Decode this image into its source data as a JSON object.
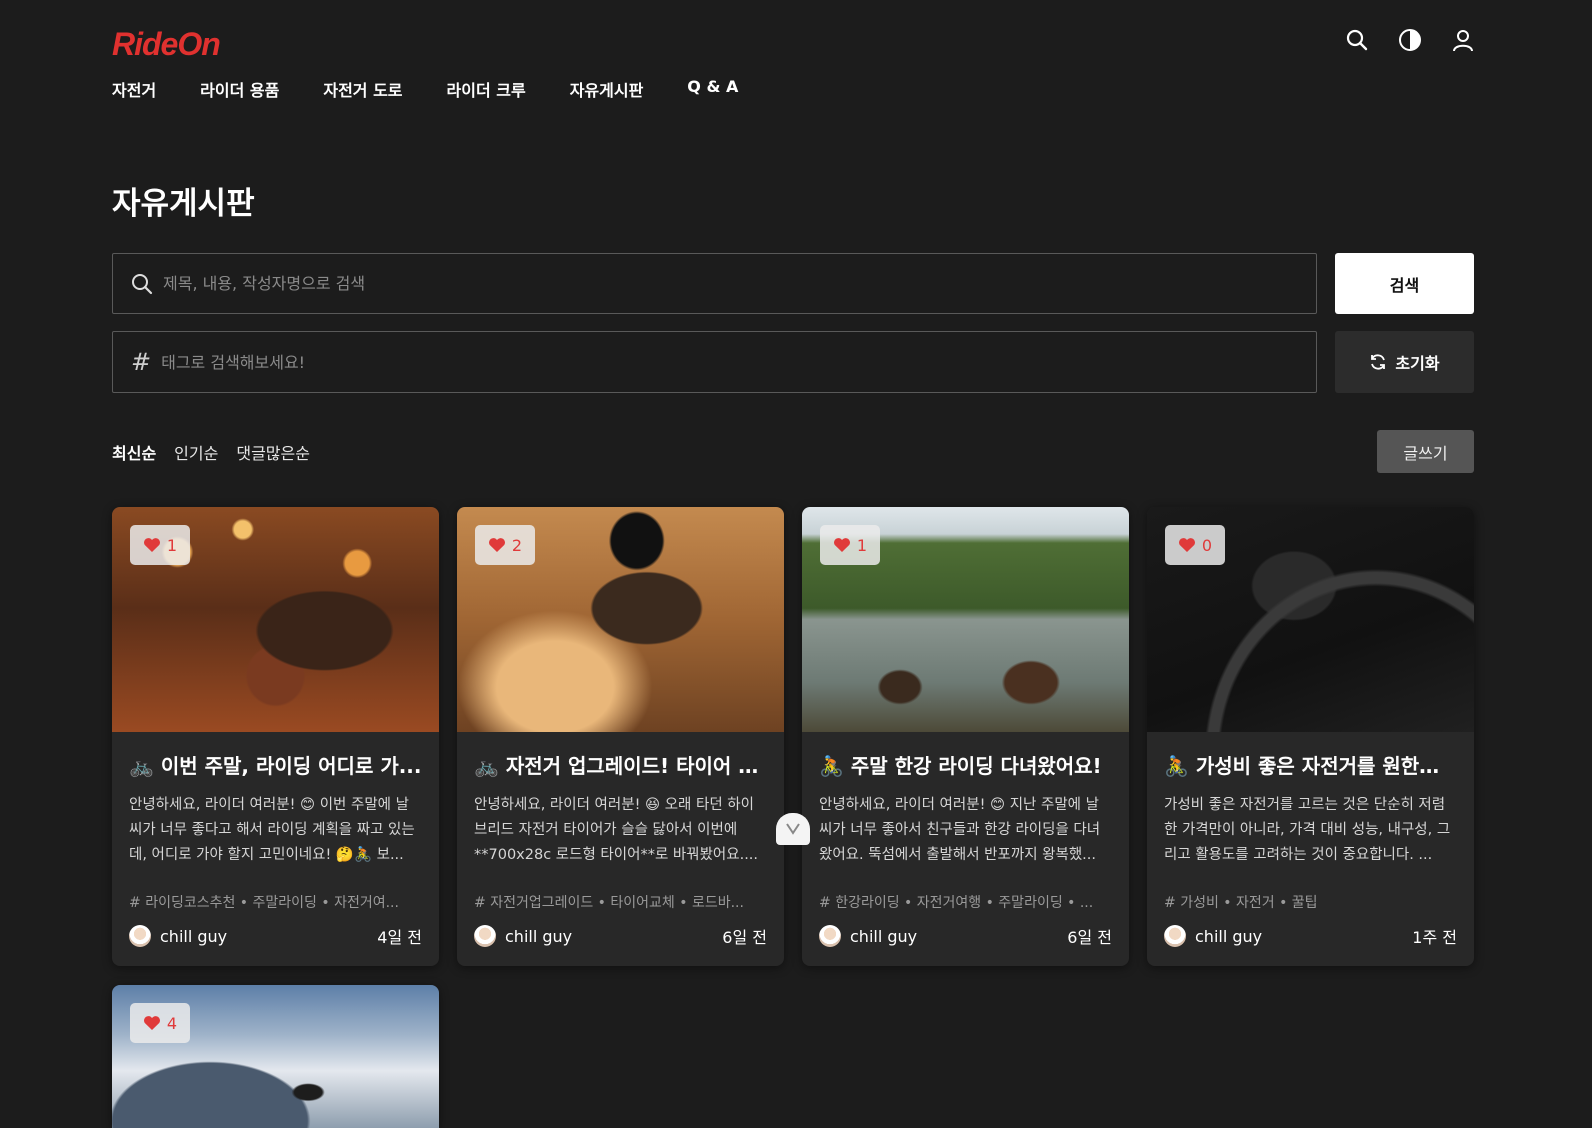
{
  "header": {
    "logo": "RideOn",
    "nav": [
      "자전거",
      "라이더 용품",
      "자전거 도로",
      "라이더 크루",
      "자유게시판",
      "Q & A"
    ]
  },
  "page": {
    "title": "자유게시판",
    "search_placeholder": "제목, 내용, 작성자명으로 검색",
    "search_button": "검색",
    "tag_placeholder": "태그로 검색해보세요!",
    "reset_button": "초기화",
    "sort": [
      "최신순",
      "인기순",
      "댓글많은순"
    ],
    "sort_active": "최신순",
    "write_button": "글쓰기"
  },
  "posts": [
    {
      "likes": "1",
      "title": "🚲 이번 주말, 라이딩 어디로 가...",
      "excerpt": "안녕하세요, 라이더 여러분! 😊 이번 주말에 날씨가 너무 좋다고 해서 라이딩 계획을 짜고 있는데, 어디로 가야 할지 고민이네요! 🤔🚴 보...",
      "tags": "라이딩코스추천 • 주말라이딩 • 자전거여...",
      "author": "chill guy",
      "time": "4일 전"
    },
    {
      "likes": "2",
      "title": "🚲 자전거 업그레이드! 타이어 교...",
      "excerpt": "안녕하세요, 라이더 여러분! 😆 오래 타던 하이브리드 자전거 타이어가 슬슬 닳아서 이번에 **700x28c 로드형 타이어**로 바꿔봤어요....",
      "tags": "자전거업그레이드 • 타이어교체 • 로드바...",
      "author": "chill guy",
      "time": "6일 전"
    },
    {
      "likes": "1",
      "title": "🚴 주말 한강 라이딩 다녀왔어요!",
      "excerpt": "안녕하세요, 라이더 여러분! 😊 지난 주말에 날씨가 너무 좋아서 친구들과 한강 라이딩을 다녀왔어요. 뚝섬에서 출발해서 반포까지 왕복했...",
      "tags": "한강라이딩 • 자전거여행 • 주말라이딩 • ...",
      "author": "chill guy",
      "time": "6일 전"
    },
    {
      "likes": "0",
      "title": "🚴 가성비 좋은 자전거를 원한다...",
      "excerpt": "가성비 좋은 자전거를 고르는 것은 단순히 저렴한 가격만이 아니라, 가격 대비 성능, 내구성, 그리고 활용도를 고려하는 것이 중요합니다. ...",
      "tags": "가성비 • 자전거 • 꿀팁",
      "author": "chill guy",
      "time": "1주 전"
    },
    {
      "likes": "4"
    }
  ],
  "colors": {
    "background": "#1c1c1c",
    "card": "#282828",
    "brand": "#e0312f",
    "heart": "#e03a3a"
  }
}
